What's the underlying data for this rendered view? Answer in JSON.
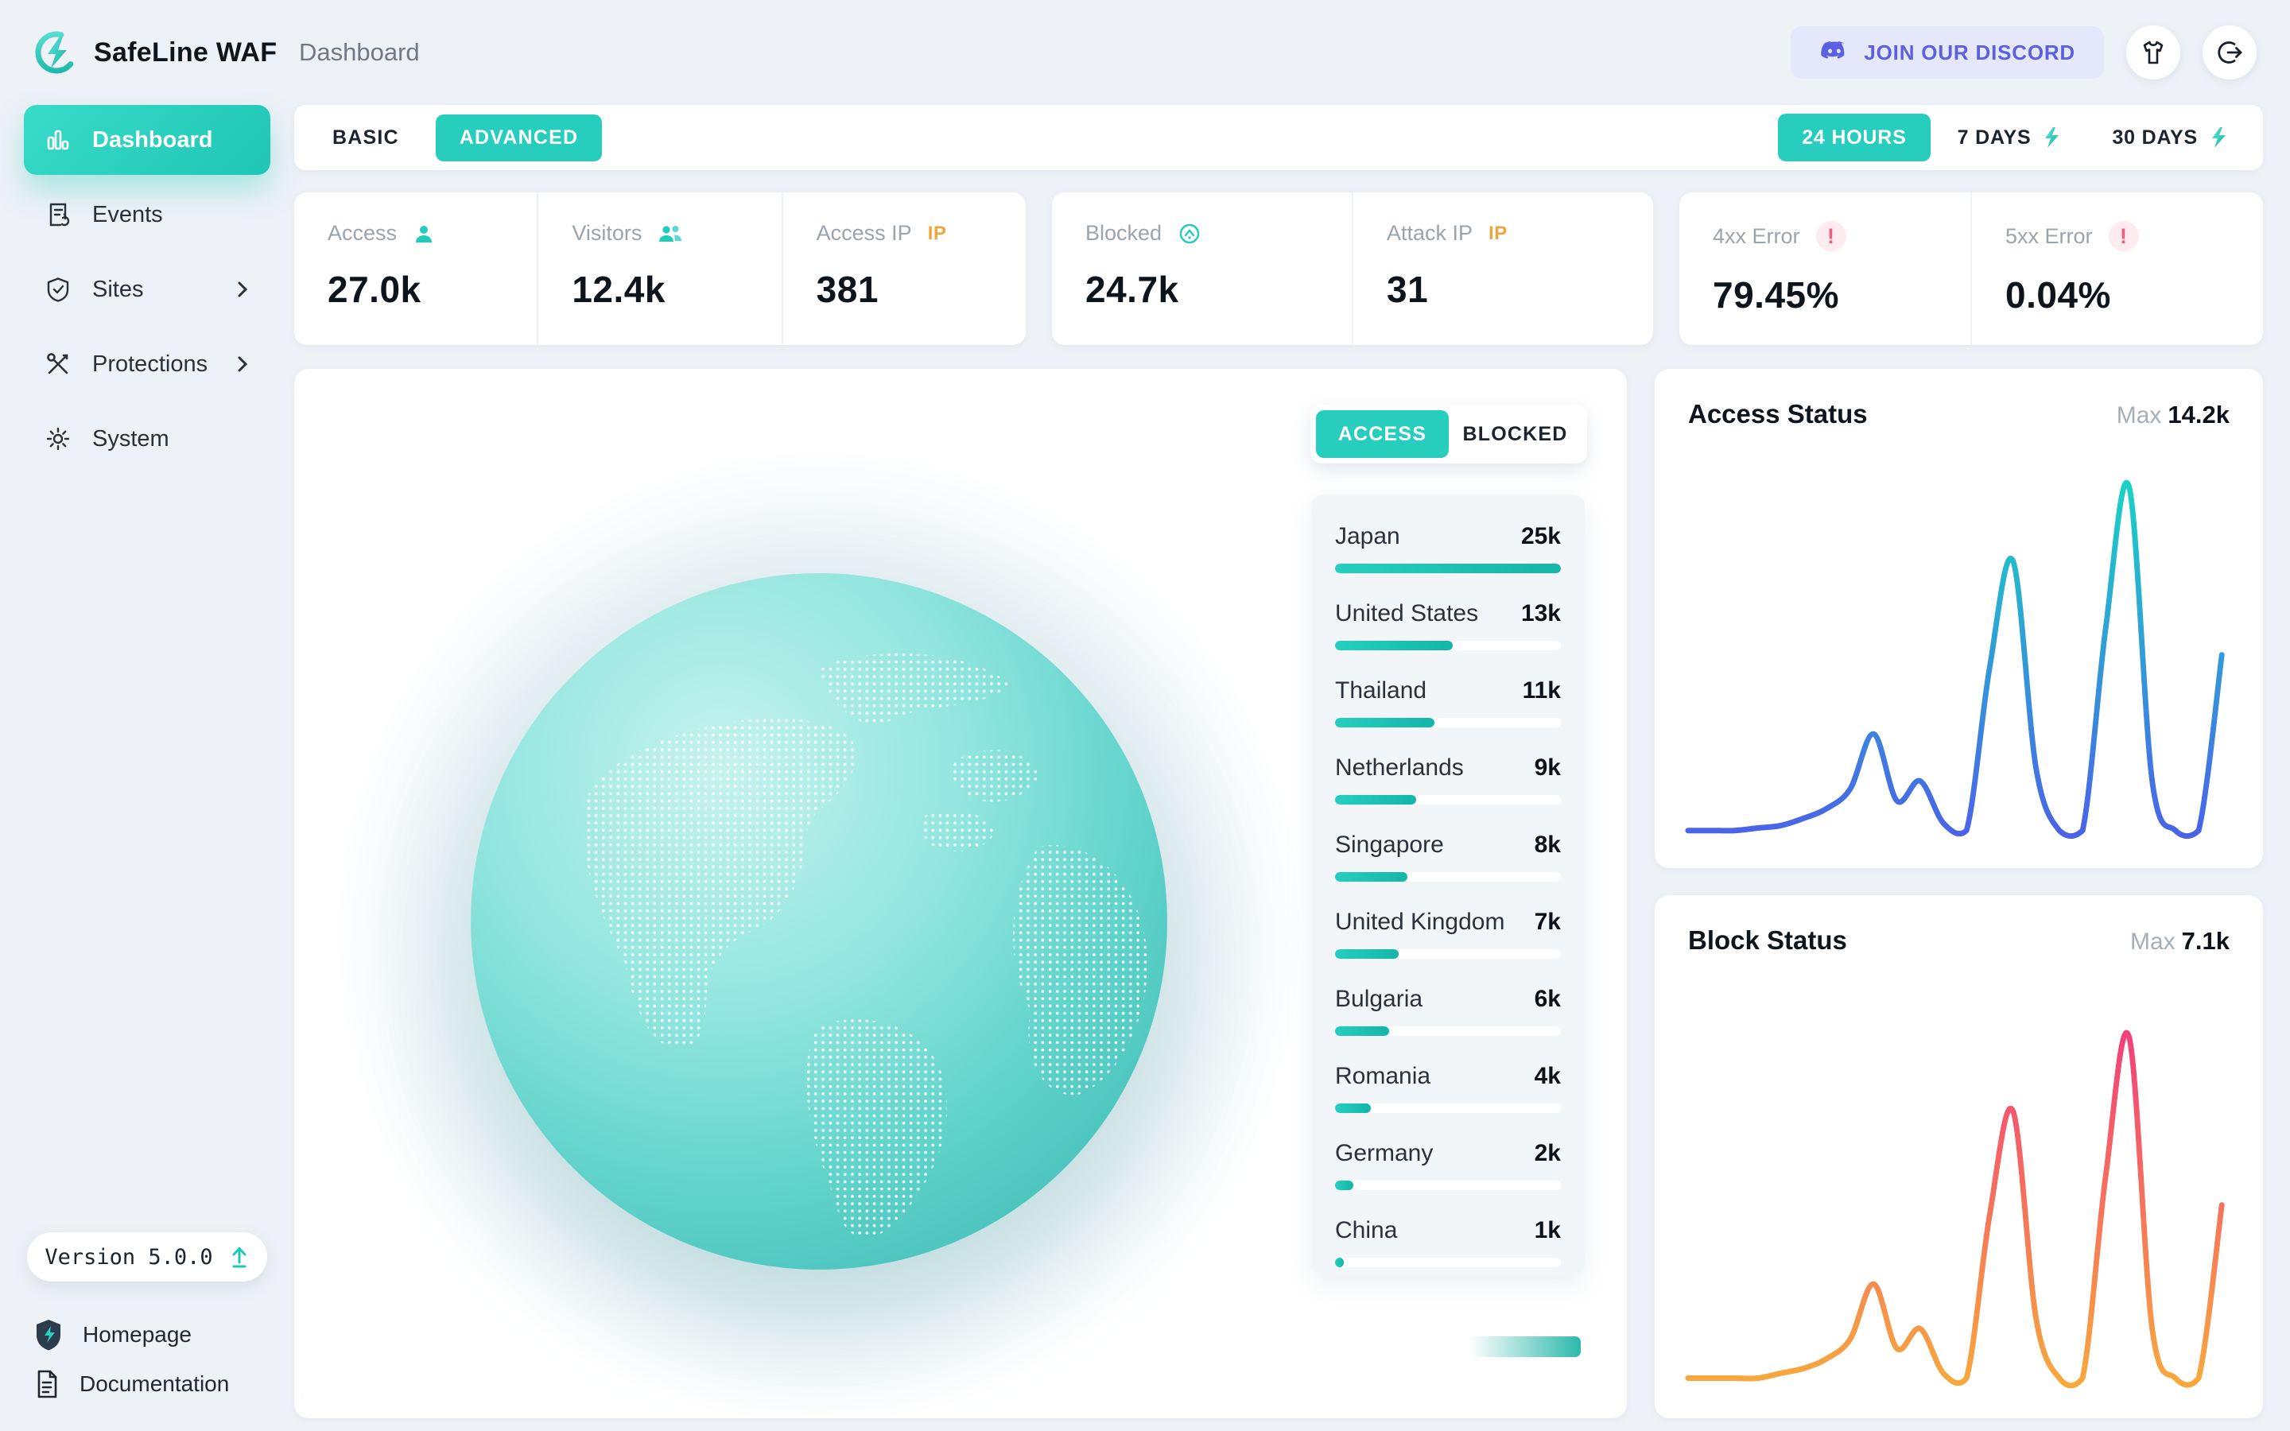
{
  "app": {
    "brand": "SafeLine WAF",
    "page_title": "Dashboard"
  },
  "header": {
    "discord_button": "JOIN OUR DISCORD"
  },
  "sidebar": {
    "items": [
      {
        "label": "Dashboard",
        "icon": "bar-chart-icon",
        "active": true
      },
      {
        "label": "Events",
        "icon": "event-log-icon",
        "active": false
      },
      {
        "label": "Sites",
        "icon": "shield-check-icon",
        "active": false,
        "has_chevron": true
      },
      {
        "label": "Protections",
        "icon": "tools-icon",
        "active": false,
        "has_chevron": true
      },
      {
        "label": "System",
        "icon": "gear-icon",
        "active": false
      }
    ],
    "version_label": "Version 5.0.0",
    "links": [
      {
        "label": "Homepage",
        "icon": "safeline-shield-icon"
      },
      {
        "label": "Documentation",
        "icon": "document-icon"
      }
    ]
  },
  "toolbar": {
    "mode_tabs": [
      {
        "label": "BASIC",
        "active": false
      },
      {
        "label": "ADVANCED",
        "active": true
      }
    ],
    "ranges": [
      {
        "label": "24 HOURS",
        "active": true
      },
      {
        "label": "7 DAYS",
        "active": false
      },
      {
        "label": "30 DAYS",
        "active": false
      }
    ]
  },
  "stats_groups": [
    {
      "items": [
        {
          "label": "Access",
          "value": "27.0k",
          "icon": "user-icon"
        },
        {
          "label": "Visitors",
          "value": "12.4k",
          "icon": "users-icon"
        },
        {
          "label": "Access IP",
          "value": "381",
          "icon": "ip-badge",
          "badge_text": "IP"
        }
      ]
    },
    {
      "items": [
        {
          "label": "Blocked",
          "value": "24.7k",
          "icon": "blocked-icon"
        },
        {
          "label": "Attack IP",
          "value": "31",
          "icon": "ip-badge",
          "badge_text": "IP"
        }
      ]
    },
    {
      "items": [
        {
          "label": "4xx Error",
          "value": "79.45%",
          "icon": "alert-icon",
          "badge_text": "!"
        },
        {
          "label": "5xx Error",
          "value": "0.04%",
          "icon": "alert-icon",
          "badge_text": "!"
        }
      ]
    }
  ],
  "map": {
    "toggle": {
      "options": [
        {
          "label": "ACCESS",
          "active": true
        },
        {
          "label": "BLOCKED",
          "active": false
        }
      ]
    },
    "countries": [
      {
        "name": "Japan",
        "value": "25k",
        "pct": 100
      },
      {
        "name": "United States",
        "value": "13k",
        "pct": 52
      },
      {
        "name": "Thailand",
        "value": "11k",
        "pct": 44
      },
      {
        "name": "Netherlands",
        "value": "9k",
        "pct": 36
      },
      {
        "name": "Singapore",
        "value": "8k",
        "pct": 32
      },
      {
        "name": "United Kingdom",
        "value": "7k",
        "pct": 28
      },
      {
        "name": "Bulgaria",
        "value": "6k",
        "pct": 24
      },
      {
        "name": "Romania",
        "value": "4k",
        "pct": 16
      },
      {
        "name": "Germany",
        "value": "2k",
        "pct": 8
      },
      {
        "name": "China",
        "value": "1k",
        "pct": 4
      }
    ]
  },
  "chart_data": [
    {
      "type": "line",
      "title": "Access Status",
      "max_label": "Max",
      "max_value": "14.2k",
      "ymax": 14.2,
      "values": [
        0.3,
        0.3,
        0.3,
        0.4,
        0.5,
        0.8,
        1.2,
        2.0,
        4.2,
        1.5,
        2.3,
        0.6,
        0.3,
        6.9,
        11.2,
        2.8,
        0.3,
        0.3,
        8.5,
        14.2,
        2.3,
        0.3,
        0.3,
        7.4
      ],
      "color_top": "#19d2c5",
      "color_bottom": "#4a63e8"
    },
    {
      "type": "line",
      "title": "Block Status",
      "max_label": "Max",
      "max_value": "7.1k",
      "ymax": 7.1,
      "values": [
        0.2,
        0.2,
        0.2,
        0.2,
        0.3,
        0.4,
        0.6,
        1.0,
        2.1,
        0.8,
        1.2,
        0.3,
        0.2,
        3.5,
        5.6,
        1.4,
        0.2,
        0.2,
        4.3,
        7.1,
        1.2,
        0.2,
        0.2,
        3.7
      ],
      "color_top": "#f2407a",
      "color_bottom": "#f7a93c"
    },
    {
      "type": "bar",
      "title": "Top source countries",
      "categories": [
        "Japan",
        "United States",
        "Thailand",
        "Netherlands",
        "Singapore",
        "United Kingdom",
        "Bulgaria",
        "Romania",
        "Germany",
        "China"
      ],
      "values_k": [
        25,
        13,
        11,
        9,
        8,
        7,
        6,
        4,
        2,
        1
      ]
    }
  ]
}
